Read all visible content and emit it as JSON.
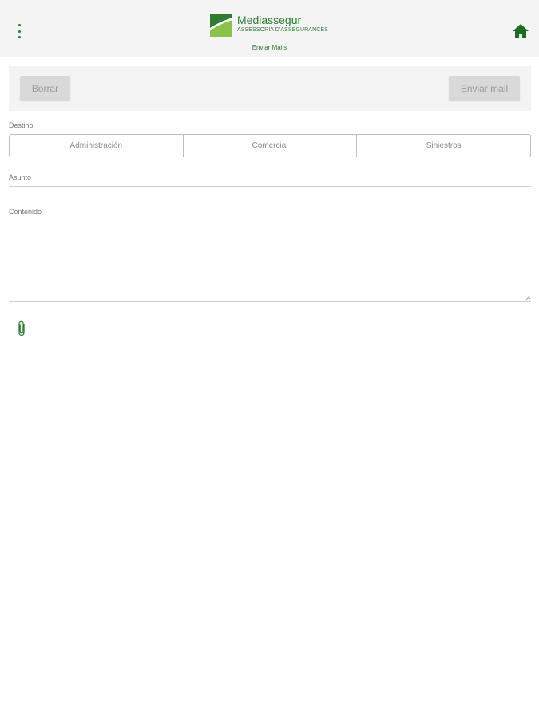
{
  "header": {
    "brand_name": "Mediassegur",
    "brand_tagline": "ASSESSORIA D'ASSEGURANCES",
    "subtitle": "Enviar Mails",
    "menu_icon": "more-vert-icon",
    "home_icon": "home-icon",
    "accent_color": "#2e7d32"
  },
  "toolbar": {
    "clear_label": "Borrar",
    "send_label": "Enviar mail"
  },
  "form": {
    "destino_label": "Destino",
    "destinations": [
      "Administración",
      "Comercial",
      "Siniestros"
    ],
    "subject_label": "Asunto",
    "content_label": "Contenido",
    "attach_icon": "paperclip-icon"
  }
}
